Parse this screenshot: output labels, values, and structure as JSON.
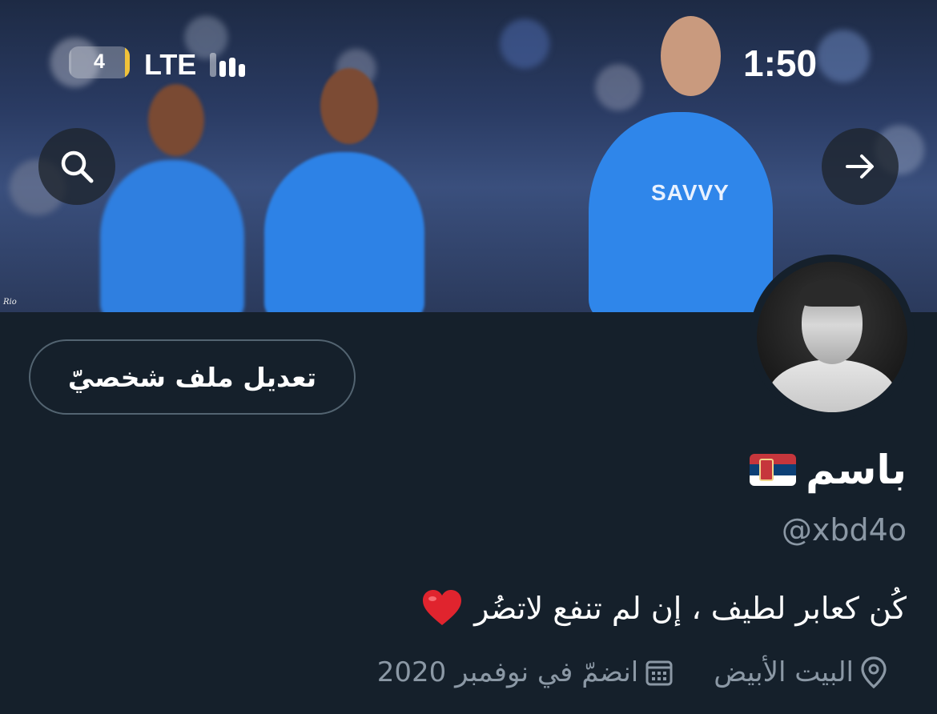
{
  "banner": {
    "jersey_sponsor": "SAVVY",
    "credit": "Rio"
  },
  "status_bar": {
    "time": "1:50",
    "network": "LTE",
    "battery_level": "4",
    "battery_icon": "battery-icon",
    "signal_icon": "signal-bars-icon"
  },
  "nav": {
    "search_icon": "search-icon",
    "forward_icon": "arrow-right-icon"
  },
  "profile": {
    "edit_label": "تعديل ملف شخصيّ",
    "display_name": "باسم",
    "flag_icon": "serbia-flag-icon",
    "handle": "@xbd4o",
    "bio": "كُن كعابر لطيف ، إن لم تنفع لاتضُر",
    "bio_emoji": "heart-icon",
    "location": "البيت الأبيض",
    "location_icon": "location-pin-icon",
    "joined": "انضمّ في نوفمبر 2020",
    "joined_icon": "calendar-icon"
  },
  "colors": {
    "background": "#15202b",
    "muted_text": "#8b98a5",
    "border": "#536471",
    "heart": "#e0242e"
  }
}
